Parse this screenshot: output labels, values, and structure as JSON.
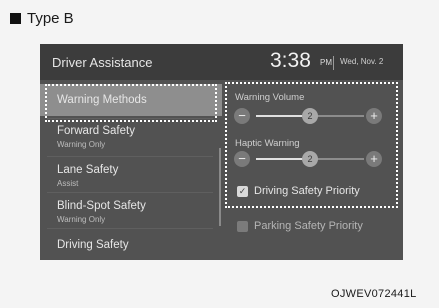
{
  "section_heading": "Type B",
  "screen": {
    "header": {
      "title": "Driver Assistance",
      "time": "3:38",
      "ampm": "PM",
      "date": "Wed, Nov. 2"
    },
    "menu_items": [
      {
        "label": "Warning Methods",
        "sub": "",
        "selected": true
      },
      {
        "label": "Forward Safety",
        "sub": "Warning Only"
      },
      {
        "label": "Lane Safety",
        "sub": "Assist"
      },
      {
        "label": "Blind-Spot Safety",
        "sub": "Warning Only"
      },
      {
        "label": "Driving Safety",
        "sub": ""
      }
    ],
    "settings": {
      "warning_volume": {
        "label": "Warning Volume",
        "value": 2,
        "level_fraction": 0.5,
        "minus": "−",
        "plus": "+"
      },
      "haptic_warning": {
        "label": "Haptic Warning",
        "value": 2,
        "level_fraction": 0.5,
        "minus": "−",
        "plus": "+"
      },
      "driving_safety_priority": {
        "label": "Driving Safety Priority",
        "checked": true
      },
      "parking_safety_priority": {
        "label": "Parking Safety Priority",
        "checked": false
      }
    }
  },
  "image_code": "OJWEV072441L",
  "icons": [
    "minus-icon",
    "plus-icon",
    "check-icon"
  ],
  "colors": {
    "screen_bg": "#525252",
    "header_bg": "#3c3c3c",
    "selected_bg": "#8e8e8e",
    "frame": "#ffffff"
  }
}
